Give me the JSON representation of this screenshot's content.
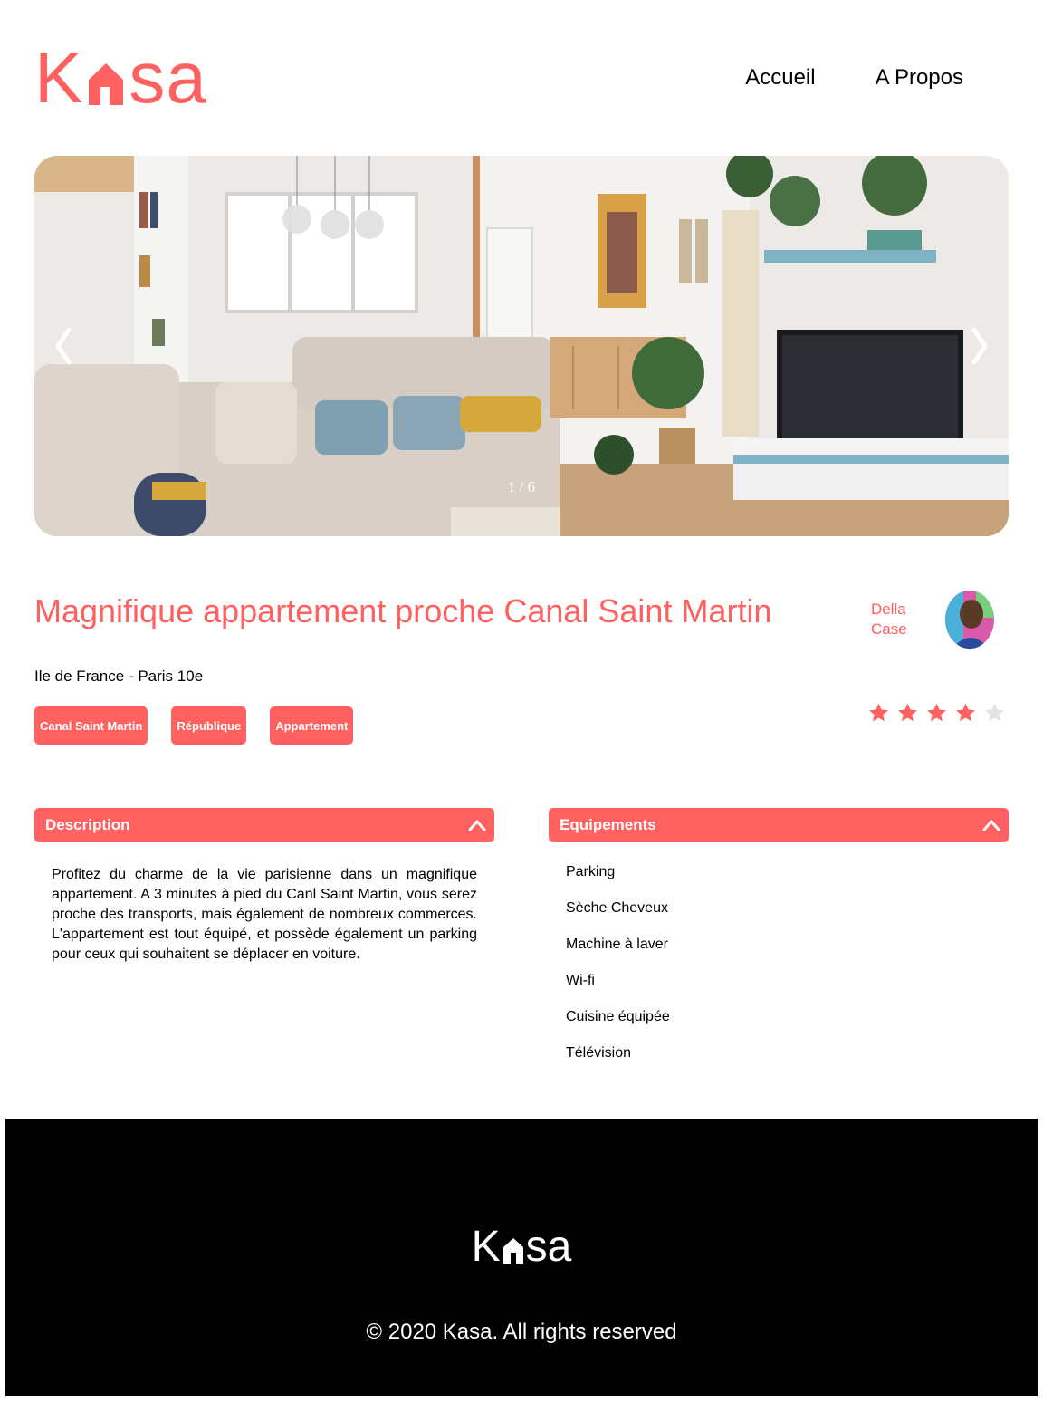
{
  "brand": {
    "logo_left": "K",
    "logo_right": "sa",
    "color": "#FF6060"
  },
  "nav": {
    "items": [
      {
        "label": "Accueil"
      },
      {
        "label": "A Propos"
      }
    ]
  },
  "carousel": {
    "counter": "1 / 6",
    "prev_icon": "chevron-left-icon",
    "next_icon": "chevron-right-icon"
  },
  "listing": {
    "title": "Magnifique appartement proche Canal Saint Martin",
    "location": "Ile de France - Paris 10e",
    "tags": [
      "Canal Saint Martin",
      "République",
      "Appartement"
    ],
    "host": {
      "first_name": "Della",
      "last_name": "Case"
    },
    "rating": 4,
    "rating_max": 5
  },
  "sections": {
    "description": {
      "title": "Description",
      "text": "Profitez du charme de la vie parisienne dans un magnifique appartement. A 3 minutes à pied du Canl Saint Martin, vous serez proche des transports, mais également de nombreux commerces. L'appartement est tout équipé, et possède également un parking pour ceux qui souhaitent se déplacer en voiture."
    },
    "equipments": {
      "title": "Equipements",
      "items": [
        "Parking",
        "Sèche Cheveux",
        "Machine à laver",
        "Wi-fi",
        "Cuisine équipée",
        "Télévision"
      ]
    }
  },
  "footer": {
    "logo_left": "K",
    "logo_right": "sa",
    "copyright": "© 2020 Kasa. All rights reserved"
  },
  "colors": {
    "accent": "#FF6060",
    "star_filled": "#FF6060",
    "star_empty": "#E3E3E3"
  }
}
